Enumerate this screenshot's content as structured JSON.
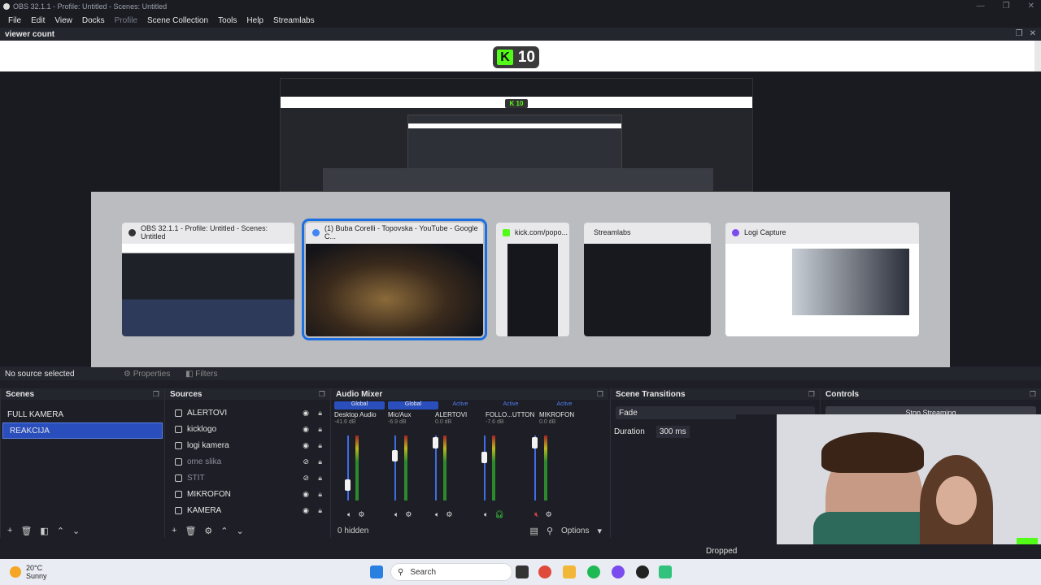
{
  "window": {
    "title": "OBS 32.1.1 - Profile: Untitled - Scenes: Untitled",
    "controls": [
      "—",
      "❐",
      "✕"
    ]
  },
  "menu": [
    "File",
    "Edit",
    "View",
    "Docks",
    "Profile",
    "Scene Collection",
    "Tools",
    "Help",
    "Streamlabs"
  ],
  "viewer_dock": {
    "title": "viewer count",
    "kick_count": "10"
  },
  "switcher": {
    "windows": [
      {
        "title": "OBS 32.1.1 - Profile: Untitled - Scenes: Untitled",
        "icon": "obs-icon"
      },
      {
        "title": "(1) Buba Corelli - Topovska - YouTube - Google C...",
        "icon": "chrome-icon"
      },
      {
        "title": "kick.com/popo...",
        "icon": "kick-icon"
      },
      {
        "title": "Streamlabs",
        "icon": "streamlabs-icon"
      },
      {
        "title": "Logi Capture",
        "icon": "logi-icon"
      }
    ]
  },
  "properties_bar": {
    "no_source": "No source selected",
    "properties": "Properties",
    "filters": "Filters"
  },
  "scenes": {
    "title": "Scenes",
    "items": [
      "FULL KAMERA",
      "REAKCIJA"
    ],
    "selected": "REAKCIJA"
  },
  "sources": {
    "title": "Sources",
    "items": [
      {
        "name": "ALERTOVI",
        "visible": true
      },
      {
        "name": "kicklogo",
        "visible": true
      },
      {
        "name": "logi kamera",
        "visible": true
      },
      {
        "name": "ome slika",
        "visible": false
      },
      {
        "name": "STIT",
        "visible": false
      },
      {
        "name": "MIKROFON",
        "visible": true
      },
      {
        "name": "KAMERA",
        "visible": true
      }
    ]
  },
  "audio_mixer": {
    "title": "Audio Mixer",
    "channels": [
      {
        "badge": "Global",
        "name": "Desktop Audio",
        "db": "-41.6 dB"
      },
      {
        "badge": "Global",
        "name": "Mic/Aux",
        "db": "-6.9 dB"
      },
      {
        "badge": "Active",
        "name": "ALERTOVI",
        "db": "0.0 dB"
      },
      {
        "badge": "Active",
        "name": "FOLLO...UTTON",
        "db": "-7.6 dB"
      },
      {
        "badge": "Active",
        "name": "MIKROFON",
        "db": "0.0 dB"
      }
    ],
    "hidden": "0 hidden",
    "options": "Options"
  },
  "scene_transitions": {
    "title": "Scene Transitions",
    "transition": "Fade",
    "duration_label": "Duration",
    "duration_value": "300 ms"
  },
  "controls": {
    "title": "Controls",
    "stop_streaming": "Stop Streaming"
  },
  "status": {
    "dropped": "Dropped"
  },
  "taskbar": {
    "temperature": "20°C",
    "weather": "Sunny",
    "search": "Search"
  },
  "colors": {
    "accent": "#2a4fbd",
    "kick_green": "#53fc18",
    "selection_outline": "#1c6fe0"
  }
}
